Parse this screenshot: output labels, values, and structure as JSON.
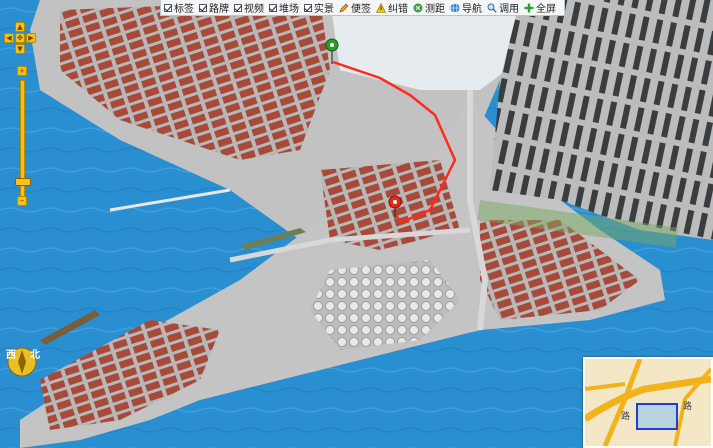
{
  "toolbar": {
    "items": [
      {
        "label": "标签",
        "checked": true
      },
      {
        "label": "路牌",
        "checked": true
      },
      {
        "label": "视频",
        "checked": true
      },
      {
        "label": "堆场",
        "checked": true
      },
      {
        "label": "实景",
        "checked": true
      }
    ],
    "tools": [
      {
        "label": "便签",
        "icon": "pencil-icon"
      },
      {
        "label": "纠错",
        "icon": "warning-icon"
      },
      {
        "label": "测距",
        "icon": "ruler-icon"
      },
      {
        "label": "导航",
        "icon": "globe-icon"
      },
      {
        "label": "调用",
        "icon": "magnifier-icon"
      },
      {
        "label": "全屏",
        "icon": "plus-icon"
      }
    ]
  },
  "navigation": {
    "pan_arrows": [
      "pan-up-icon",
      "pan-left-icon",
      "pan-right-icon",
      "pan-down-icon"
    ],
    "zoom_in": "+",
    "zoom_out": "−"
  },
  "compass": {
    "west": "西",
    "north": "北"
  },
  "colors": {
    "sea": "#2a8fd0",
    "route": "#ff2a1a",
    "land": "#c9c9c9",
    "warehouse_roof": "#a84a3a"
  },
  "minimap": {
    "label_left": "路",
    "label_right": "路"
  }
}
